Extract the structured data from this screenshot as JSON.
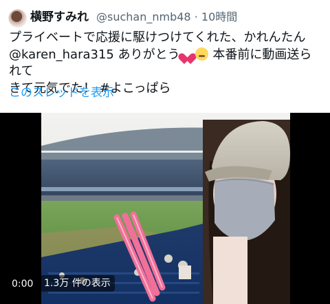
{
  "tweet": {
    "author_name": "横野すみれ",
    "handle": "@suchan_nmb48",
    "separator": "·",
    "time": "10時間",
    "text_line1": "プライベートで応援に駆けつけてくれた、かれんたん",
    "mention": "@karen_hara315",
    "text_after_mention": " ありがとう",
    "text_line2_end": " 本番前に動画送られて",
    "text_line3": "きて元気でた！ ",
    "hashtag": "#よこっぱら",
    "emoji_1": "heart-emoji",
    "emoji_2": "relieved-face-emoji",
    "show_thread_label": "このスレッドを表示"
  },
  "video": {
    "time": "0:00",
    "views": "1.3万 件の表示"
  },
  "colors": {
    "link": "#1d9bf0",
    "secondary_text": "#536471",
    "background": "#ffffff",
    "media_background": "#000000"
  }
}
